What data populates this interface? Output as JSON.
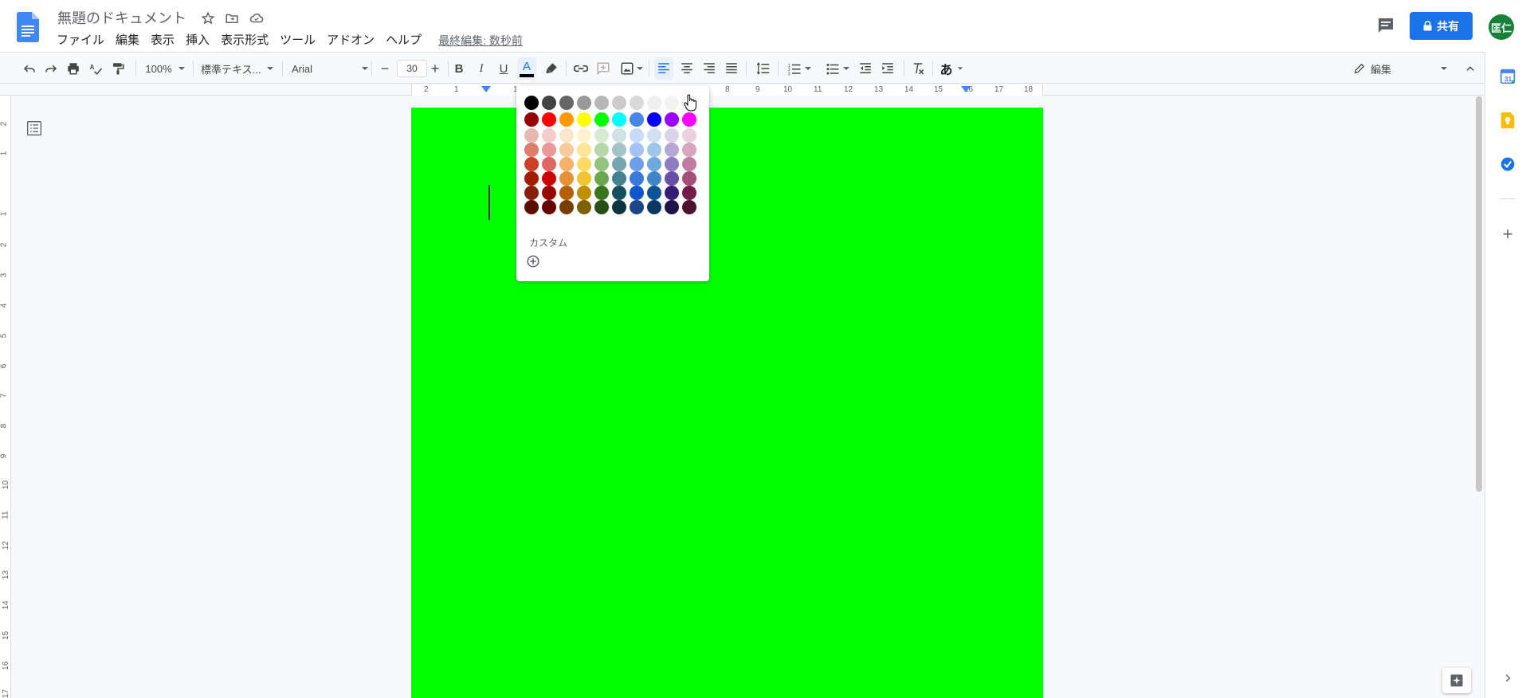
{
  "header": {
    "title": "無題のドキュメント",
    "menu": [
      "ファイル",
      "編集",
      "表示",
      "挿入",
      "表示形式",
      "ツール",
      "アドオン",
      "ヘルプ"
    ],
    "last_edit": "最終編集: 数秒前",
    "share_label": "共有",
    "avatar_text": "匡仁"
  },
  "toolbar": {
    "zoom": "100%",
    "style": "標準テキス...",
    "font": "Arial",
    "font_size": "30",
    "bold": "B",
    "italic": "I",
    "underline": "U",
    "text_color": "A",
    "input_tool": "あ",
    "mode": "編集"
  },
  "ruler": {
    "h_labels": [
      "2",
      "1",
      "1",
      "8",
      "9",
      "10",
      "11",
      "12",
      "13",
      "14",
      "15",
      "16",
      "17",
      "18"
    ],
    "v_labels": [
      "2",
      "1",
      "1",
      "2",
      "3",
      "4",
      "5",
      "6",
      "7",
      "8",
      "9",
      "10",
      "11",
      "12",
      "13",
      "14",
      "15",
      "16",
      "17"
    ]
  },
  "palette": {
    "custom_label": "カスタム",
    "rows": [
      [
        "#000000",
        "#434343",
        "#666666",
        "#999999",
        "#b7b7b7",
        "#cccccc",
        "#d9d9d9",
        "#efefef",
        "#f3f3f3",
        "#ffffff"
      ],
      [
        "#980000",
        "#ff0000",
        "#ff9900",
        "#ffff00",
        "#00ff00",
        "#00ffff",
        "#4a86e8",
        "#0000ff",
        "#9900ff",
        "#ff00ff"
      ],
      [
        "#e6b8af",
        "#f4cccc",
        "#fce5cd",
        "#fff2cc",
        "#d9ead3",
        "#d0e0e3",
        "#c9daf8",
        "#cfe2f3",
        "#d9d2e9",
        "#ead1dc"
      ],
      [
        "#dd7e6b",
        "#ea9999",
        "#f9cb9c",
        "#ffe599",
        "#b6d7a8",
        "#a2c4c9",
        "#a4c2f4",
        "#9fc5e8",
        "#b4a7d6",
        "#d5a6bd"
      ],
      [
        "#cc4125",
        "#e06666",
        "#f6b26b",
        "#ffd966",
        "#93c47d",
        "#76a5af",
        "#6d9eeb",
        "#6fa8dc",
        "#8e7cc3",
        "#c27ba0"
      ],
      [
        "#a61c00",
        "#cc0000",
        "#e69138",
        "#f1c232",
        "#6aa84f",
        "#45818e",
        "#3c78d8",
        "#3d85c6",
        "#674ea7",
        "#a64d79"
      ],
      [
        "#85200c",
        "#990000",
        "#b45f06",
        "#bf9000",
        "#38761d",
        "#134f5c",
        "#1155cc",
        "#0b5394",
        "#351c75",
        "#741b47"
      ],
      [
        "#5b0f00",
        "#660000",
        "#783f04",
        "#7f6000",
        "#274e13",
        "#0c343d",
        "#1c4587",
        "#073763",
        "#20124d",
        "#4c1130"
      ]
    ]
  },
  "colors": {
    "page_background": "#00ff00",
    "accent": "#1a73e8",
    "avatar": "#188038"
  }
}
